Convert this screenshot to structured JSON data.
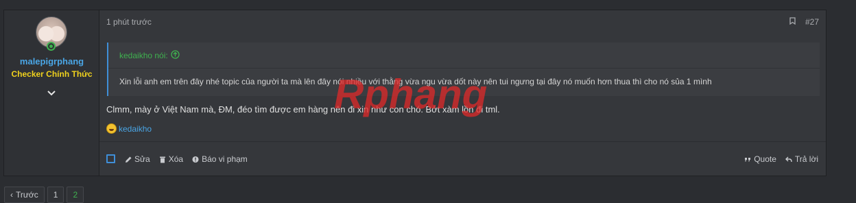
{
  "post": {
    "user": {
      "name": "malepigrphang",
      "title": "Checker Chính Thức"
    },
    "timestamp": "1 phút trước",
    "post_number": "#27",
    "quote": {
      "author_line": "kedaikho nói:",
      "text": "Xin lỗi anh em trên đây nhé topic của người ta mà lên đây nói nhiều với thằng vừa ngu vừa dốt này nên tui ngưng tại đây nó muốn hơn thua thì cho nó sủa 1 mình"
    },
    "message": "Clmm, mày ở Việt Nam mà, ĐM, đéo tìm được em hàng nên đi xin như con chó. Bớt xàm lồn đi tml.",
    "reaction_user": "kedaikho",
    "actions": {
      "edit": "Sửa",
      "delete": "Xóa",
      "report": "Báo vi phạm",
      "quote": "Quote",
      "reply": "Trả lời"
    }
  },
  "watermark_text": "Rphang",
  "pagination": {
    "prev": "Trước",
    "pages": [
      "1",
      "2"
    ]
  },
  "colors": {
    "accent": "#3f8fd8",
    "username": "#4aa6e6",
    "title": "#f0d21d",
    "quote_author": "#3fb24f"
  }
}
